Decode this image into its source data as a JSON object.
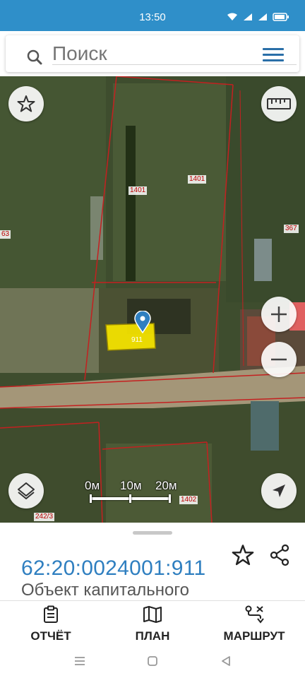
{
  "status_bar": {
    "time": "13:50"
  },
  "search": {
    "placeholder": "Поиск"
  },
  "map": {
    "parcel_labels": [
      "1401",
      "1401",
      "367",
      "63",
      "911",
      "1402",
      "242/3"
    ],
    "scale": {
      "labels": [
        "0м",
        "10м",
        "20м"
      ]
    },
    "colors": {
      "boundary": "#c42020",
      "selected_parcel": "#f2e200",
      "marker": "#2f7fc0"
    }
  },
  "parcel": {
    "cadastral_number": "62:20:0024001:911",
    "object_type": "Объект капитального"
  },
  "bottom_nav": {
    "items": [
      {
        "label": "ОТЧЁТ",
        "icon": "clipboard-icon"
      },
      {
        "label": "ПЛАН",
        "icon": "map-icon"
      },
      {
        "label": "МАРШРУТ",
        "icon": "route-icon"
      }
    ]
  }
}
